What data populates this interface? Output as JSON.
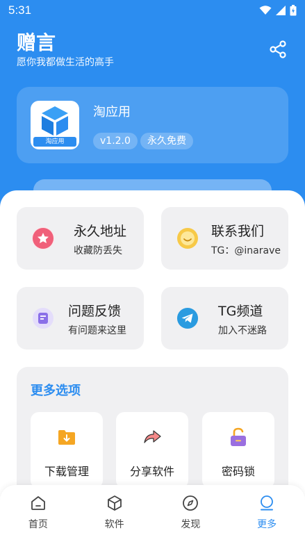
{
  "status_bar": {
    "time": "5:31"
  },
  "header": {
    "title": "赠言",
    "subtitle": "愿你我都做生活的高手"
  },
  "app_card": {
    "icon_label": "淘应用",
    "name": "淘应用",
    "version": "v1.2.0",
    "license": "永久免费"
  },
  "features": [
    {
      "title": "永久地址",
      "subtitle": "收藏防丢失",
      "icon": "star-icon",
      "color": "#f0607a"
    },
    {
      "title": "联系我们",
      "subtitle": "TG：@inarave",
      "icon": "smile-icon",
      "color": "#f7c948"
    },
    {
      "title": "问题反馈",
      "subtitle": "有问题来这里",
      "icon": "feedback-icon",
      "color": "#8a6fe8"
    },
    {
      "title": "TG频道",
      "subtitle": "加入不迷路",
      "icon": "telegram-icon",
      "color": "#2a9be0"
    }
  ],
  "more": {
    "title": "更多选项",
    "options": [
      {
        "label": "下载管理",
        "icon": "download-folder-icon",
        "color": "#f5a623"
      },
      {
        "label": "分享软件",
        "icon": "share-arrow-icon",
        "color": "#f07f7f"
      },
      {
        "label": "密码锁",
        "icon": "lock-icon",
        "color": "#9a6fe0"
      }
    ]
  },
  "tabs": [
    {
      "label": "首页",
      "icon": "home-icon"
    },
    {
      "label": "软件",
      "icon": "cube-icon"
    },
    {
      "label": "发现",
      "icon": "compass-icon"
    },
    {
      "label": "更多",
      "icon": "more-person-icon",
      "active": true
    }
  ],
  "colors": {
    "primary": "#2c8df0",
    "background": "#f2f2f4"
  }
}
